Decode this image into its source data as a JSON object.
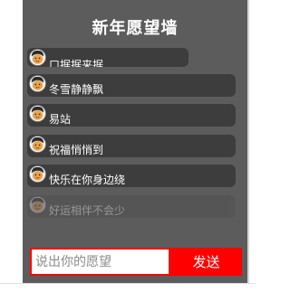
{
  "wall": {
    "title": "新年愿望墙",
    "wishes": [
      {
        "text": "口据据来据"
      },
      {
        "text": "冬雪静静飘"
      },
      {
        "text": "易站"
      },
      {
        "text": "祝福悄悄到"
      },
      {
        "text": "快乐在你身边绕"
      },
      {
        "text": "好运相伴不会少"
      }
    ]
  },
  "form": {
    "input_value": "",
    "input_placeholder": "说出你的愿望",
    "send_label": "发送"
  },
  "colors": {
    "wall_background": "#5c5c5c",
    "wish_background": "#3d3d3d",
    "accent": "#ff0000"
  }
}
